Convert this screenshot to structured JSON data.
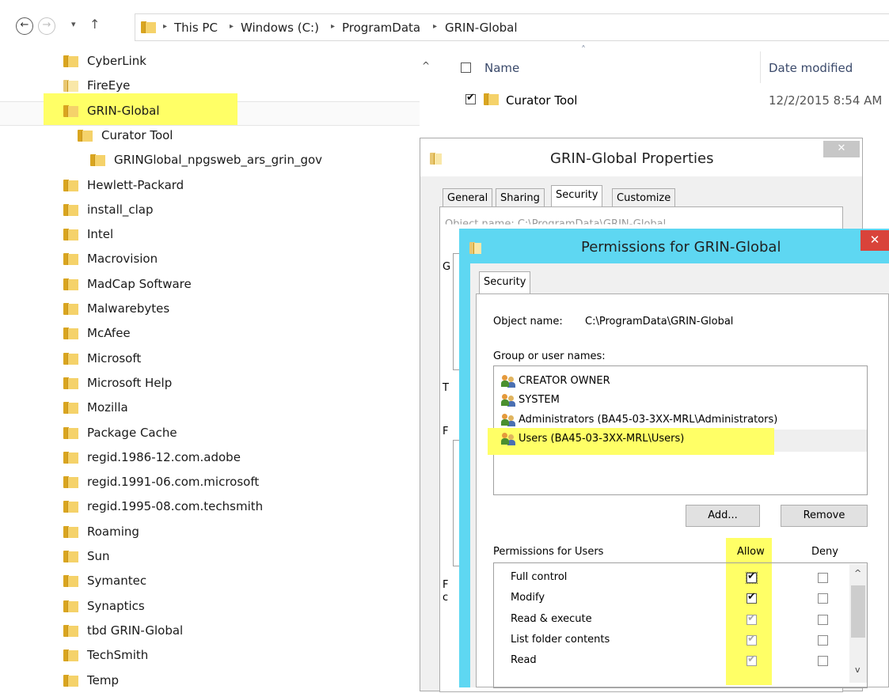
{
  "address_bar": {
    "back_glyph": "←",
    "forward_glyph": "→",
    "recent_glyph": "▾",
    "up_glyph": "↑",
    "separator": "▸",
    "crumbs": [
      "This PC",
      "Windows (C:)",
      "ProgramData",
      "GRIN-Global"
    ]
  },
  "tree": {
    "scroll_up_glyph": "^",
    "items": [
      {
        "label": "CyberLink",
        "level": 0
      },
      {
        "label": "FireEye",
        "level": 0
      },
      {
        "label": "GRIN-Global",
        "level": 0,
        "selected": true
      },
      {
        "label": "Curator Tool",
        "level": 1
      },
      {
        "label": "GRINGlobal_npgsweb_ars_grin_gov",
        "level": 2
      },
      {
        "label": "Hewlett-Packard",
        "level": 0
      },
      {
        "label": "install_clap",
        "level": 0
      },
      {
        "label": "Intel",
        "level": 0
      },
      {
        "label": "Macrovision",
        "level": 0
      },
      {
        "label": "MadCap Software",
        "level": 0
      },
      {
        "label": "Malwarebytes",
        "level": 0
      },
      {
        "label": "McAfee",
        "level": 0
      },
      {
        "label": "Microsoft",
        "level": 0
      },
      {
        "label": "Microsoft Help",
        "level": 0
      },
      {
        "label": "Mozilla",
        "level": 0
      },
      {
        "label": "Package Cache",
        "level": 0
      },
      {
        "label": "regid.1986-12.com.adobe",
        "level": 0
      },
      {
        "label": "regid.1991-06.com.microsoft",
        "level": 0
      },
      {
        "label": "regid.1995-08.com.techsmith",
        "level": 0
      },
      {
        "label": "Roaming",
        "level": 0
      },
      {
        "label": "Sun",
        "level": 0
      },
      {
        "label": "Symantec",
        "level": 0
      },
      {
        "label": "Synaptics",
        "level": 0
      },
      {
        "label": "tbd GRIN-Global",
        "level": 0
      },
      {
        "label": "TechSmith",
        "level": 0
      },
      {
        "label": "Temp",
        "level": 0
      }
    ]
  },
  "details": {
    "col_name": "Name",
    "col_date": "Date modified",
    "sort_glyph": "˄",
    "row": {
      "name": "Curator Tool",
      "date": "12/2/2015 8:54 AM"
    }
  },
  "properties_dialog": {
    "title": "GRIN-Global Properties",
    "close_glyph": "✕",
    "tabs": [
      "General",
      "Sharing",
      "Security",
      "Customize"
    ],
    "active_tab": "Security",
    "partial_text": "Object name:   C:\\ProgramData\\GRIN-Global",
    "partial_letters": [
      "G",
      "T",
      "F",
      "F",
      "c"
    ]
  },
  "permissions_dialog": {
    "title": "Permissions for GRIN-Global",
    "close_glyph": "✕",
    "tab": "Security",
    "object_name_label": "Object name:",
    "object_name_value": "C:\\ProgramData\\GRIN-Global",
    "group_label": "Group or user names:",
    "users": [
      "CREATOR OWNER",
      "SYSTEM",
      "Administrators (BA45-03-3XX-MRL\\Administrators)",
      "Users (BA45-03-3XX-MRL\\Users)"
    ],
    "selected_user": "Users (BA45-03-3XX-MRL\\Users)",
    "add_button": "Add...",
    "remove_button": "Remove",
    "permissions_label": "Permissions for Users",
    "allow_label": "Allow",
    "deny_label": "Deny",
    "scroll_up_glyph": "^",
    "scroll_down_glyph": "v",
    "permissions": [
      {
        "name": "Full control",
        "allow": true,
        "allow_inherited": false,
        "deny": false
      },
      {
        "name": "Modify",
        "allow": true,
        "allow_inherited": false,
        "deny": false
      },
      {
        "name": "Read & execute",
        "allow": true,
        "allow_inherited": true,
        "deny": false
      },
      {
        "name": "List folder contents",
        "allow": true,
        "allow_inherited": true,
        "deny": false
      },
      {
        "name": "Read",
        "allow": true,
        "allow_inherited": true,
        "deny": false
      }
    ]
  },
  "colors": {
    "highlight": "#ffff66",
    "permissions_frame": "#5ed7f2",
    "close_red": "#d9433a",
    "folder_yellow": "#f5d26a"
  }
}
